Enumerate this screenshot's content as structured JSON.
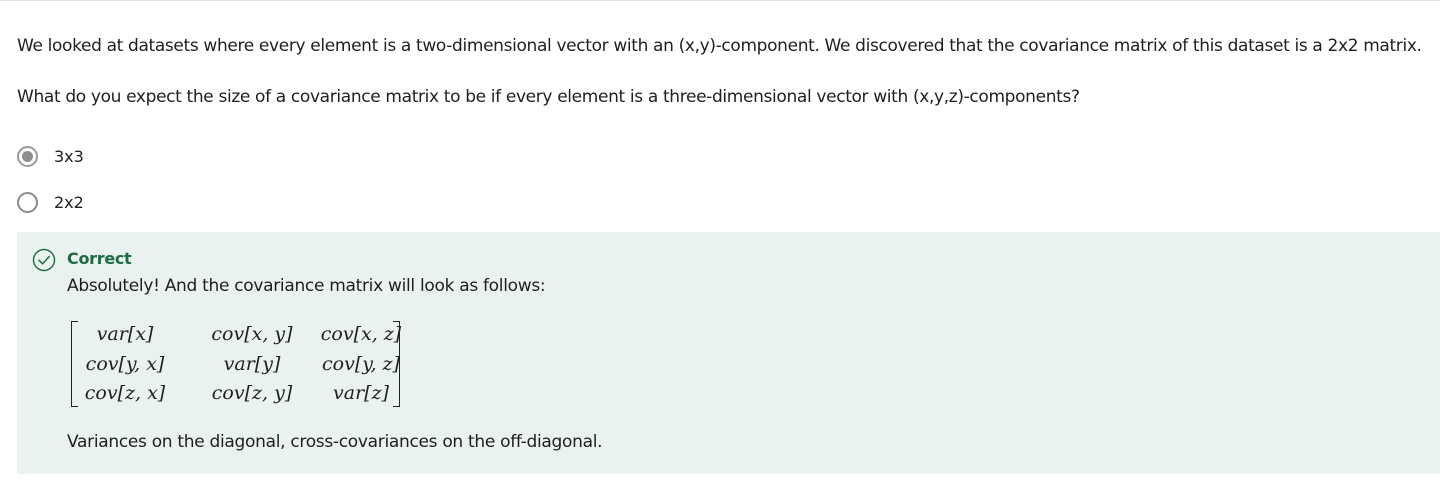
{
  "question": {
    "intro": "We looked at datasets where every element is a two-dimensional vector with an (x,y)-component. We discovered that the covariance matrix of this dataset is a 2x2 matrix.",
    "prompt": "What do you expect the size of a covariance matrix to be if every element is a three-dimensional vector with (x,y,z)-components?"
  },
  "options": [
    {
      "label": "3x3",
      "selected": true
    },
    {
      "label": "2x2",
      "selected": false
    }
  ],
  "feedback": {
    "status": "Correct",
    "message": "Absolutely! And the covariance matrix will look as follows:",
    "matrix": [
      [
        "var[x]",
        "cov[x, y]",
        "cov[x, z]"
      ],
      [
        "cov[y, x]",
        "var[y]",
        "cov[y, z]"
      ],
      [
        "cov[z, x]",
        "cov[z, y]",
        "var[z]"
      ]
    ],
    "footer": "Variances on the diagonal, cross-covariances on the off-diagonal."
  },
  "icons": {
    "correct": "check-circle-icon",
    "radio_selected": "radio-checked-icon",
    "radio_unselected": "radio-unchecked-icon"
  },
  "colors": {
    "feedback_bg": "#e9f2ee",
    "correct_green": "#1d6b3f"
  }
}
